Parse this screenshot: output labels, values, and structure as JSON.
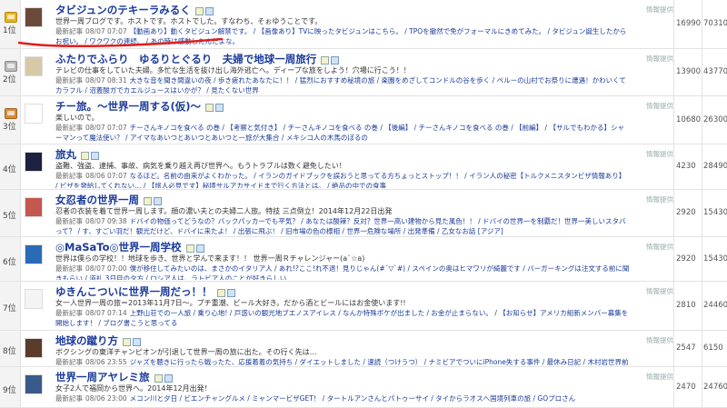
{
  "rankings": [
    {
      "rank_label": "1位",
      "badge": "gold",
      "title": "タビジュンのテキーラみるく",
      "description": "世界一周ブログです。ホストです。ホストでした。すなわち、そぉゆうことです。",
      "latest_label": "最新記事",
      "latest_date": "08/07 07:07",
      "latest_articles": "【動画あり】動くタビジュン解禁です。 / 【画像あり】TVに映ったタビジュンはこちら。 / TPOを撤然で免がフォーマルにきめてみた。 / タビジュン誕生したからお祝い。 / ワクワクの連続。 / あの時は感動したんだよな。",
      "info_label": "情報提供",
      "in_points": "16990",
      "out_points": "70310",
      "thumb_color": "#6b4a3a"
    },
    {
      "rank_label": "2位",
      "badge": "silver",
      "title": "ふたりでふらり　ゆるりとぐるり　夫婦で地球一周旅行",
      "description": "テレビの仕事をしていた夫婦。多忙な生活を抜け出し海外逃亡へ。ディープな旅をしよう！穴場に行こう！！",
      "latest_label": "最新記事",
      "latest_date": "08/07 08:31",
      "latest_articles": "大きな音を聞き間違いの夜 / 歩き疲れたあなたに！！ / 猛烈におすすめ秘境の旅 / 楽園をめざしてコンドルの谷を歩く / ペルーの山村でお祭りに遭遇！かわいくてカラフル / 沼蓋酸ガでカエルジュースはいかが？ / 見たくない世界",
      "info_label": "情報提供",
      "in_points": "13900",
      "out_points": "43770",
      "thumb_color": "#d7c9a8"
    },
    {
      "rank_label": "3位",
      "badge": "bronze",
      "title": "チー旅。～世界一周する(仮)～",
      "description": "楽しいので。",
      "latest_label": "最新記事",
      "latest_date": "08/07 07:07",
      "latest_articles": "チーさんキノコを食べる の巻 / 【考察と気付き】 / チーさんキノコを食べる の巻 / 【後編】 / チーさんキノコを食べる の巻 / 【前編】 / 【サルでもわかる】シャーマンって魔法使い？ / アイマなあいつとあいつとあいつと一旅が大集合 / メキシコ人の木馬のぼるの",
      "info_label": "情報提供",
      "in_points": "10680",
      "out_points": "26300",
      "thumb_color": "#ffffff"
    },
    {
      "rank_label": "4位",
      "badge": "none",
      "title": "旅丸",
      "description": "盗難、強盗、逮捕、事故、病気を乗り越え再び世界へ。もうトラブルは数く避免したい！",
      "latest_label": "最新記事",
      "latest_date": "08/06 07:07",
      "latest_articles": "なるほど。名前の由来がよくわかった。 / イランのガイドブックを誤おうと思ってる方ちょっとストップ！！ / イラン人の秘密【トルクメニスタンビザ情報あり】 / ビザを発給してくれない… / 【旅人必見です】秘境サルアカサイドまで行く方法とは。 / 絶品の中での食事",
      "info_label": "情報提供",
      "in_points": "4230",
      "out_points": "28490",
      "thumb_color": "#1c2240"
    },
    {
      "rank_label": "5位",
      "badge": "none",
      "title": "女忍者の世界一周",
      "description": "忍者の衣装を着て世界一周します。顔の濃い夫との夫婦二人旅。特技 三点倒立！2014年12月22日出発",
      "latest_label": "最新記事",
      "latest_date": "08/07 09:38",
      "latest_articles": "ドバイの物価ってどうなの？バックパッカーでも平気？ / あなたは酸辣？反対？世界一高い建物から見た風色！！ / ドバイの世界一を制覇だ！世界一美しいスタバって？ / す、すごい羽だ！観光だけど、ドバイに来たよ！ / 出張に飛ぶ！ / 旧市場の色の様相 / 世界一危険な場所 / 出発準備 / 乙女なお話 [アジア]",
      "info_label": "情報提供",
      "in_points": "2920",
      "out_points": "15430",
      "thumb_color": "#c4574f"
    },
    {
      "rank_label": "6位",
      "badge": "none",
      "title": "◎MaSaTo◎世界一周学校",
      "description": "世界は僕らの学校！！地球を歩き、世界と学んで来ます！！ 世界一周Ｒチャレンジャー(a¨☆a)",
      "latest_label": "最新記事",
      "latest_date": "08/07 07:00",
      "latest_articles": "僕が移住してみたいのは、まさかのイタリア人 / あれ!?ここ!れ不退！見りじゃん(#´▽`#) / スペインの奥はヒマワリが綺麗です / バーガーキングは注文する前に聞きもらい / 道礼 3日目の夕方 / ロシア人は、ラトビア人のことが好きらしい",
      "info_label": "情報提供",
      "in_points": "2920",
      "out_points": "15430",
      "thumb_color": "#2a6bb8"
    },
    {
      "rank_label": "7位",
      "badge": "none",
      "title": "ゆきんこついに世界一周だっ！！",
      "description": "女一人世界一周の旅＝2013年11月7日～。プチ重潮、ビール大好き。だから酒とビールにはお金使います!!",
      "latest_label": "最新記事",
      "latest_date": "08/07 07:14",
      "latest_articles": "上野山荘での一人旅 / 乗り心地! / 戸惑いの観光地ブエノスアイレス / なんか特殊ボケが出ました / お金が止まらない。 / 【お知らせ】アメリカ組新メンバー募集を開始します！ / ブログ書こうと思ってる",
      "info_label": "情報提供",
      "in_points": "2810",
      "out_points": "24460",
      "thumb_color": "#f4f4f4"
    },
    {
      "rank_label": "8位",
      "badge": "none",
      "title": "地球の蹴り方",
      "description": "ボクシングの東洋チャンピオンが引退して世界一周の旅に出た。その行く先は…",
      "latest_label": "最新記事",
      "latest_date": "08/06 23:55",
      "latest_articles": "ジャズを聴きに行ったら戦ったた、応援着着の気持ち / ダイエットしました / 速読（つけうつ） / ナミビアでついにiPhone失する事件 / 最休み日記 / 木村岩世界前陣戦募集中",
      "info_label": "情報提供",
      "in_points": "2547",
      "out_points": "6150",
      "thumb_color": "#5b3b2a"
    },
    {
      "rank_label": "9位",
      "badge": "none",
      "title": "世界一周アヤレミ旅",
      "description": "女子2人で福岡から世界へ。2014年12月出発！",
      "latest_label": "最新記事",
      "latest_date": "08/06 23:00",
      "latest_articles": "メコン川と夕日 / ビエンチャングルメ / ミャンマービザGET！ / タートルアンさんとパトゥーサイ / タイからラオスへ国境列車の旅 / GOプロさん",
      "info_label": "情報提供",
      "in_points": "2470",
      "out_points": "24760",
      "thumb_color": "#3b5a8c"
    }
  ],
  "colors": {
    "title_link": "#1a3a9a",
    "highlight_underline": "#e0201a"
  }
}
